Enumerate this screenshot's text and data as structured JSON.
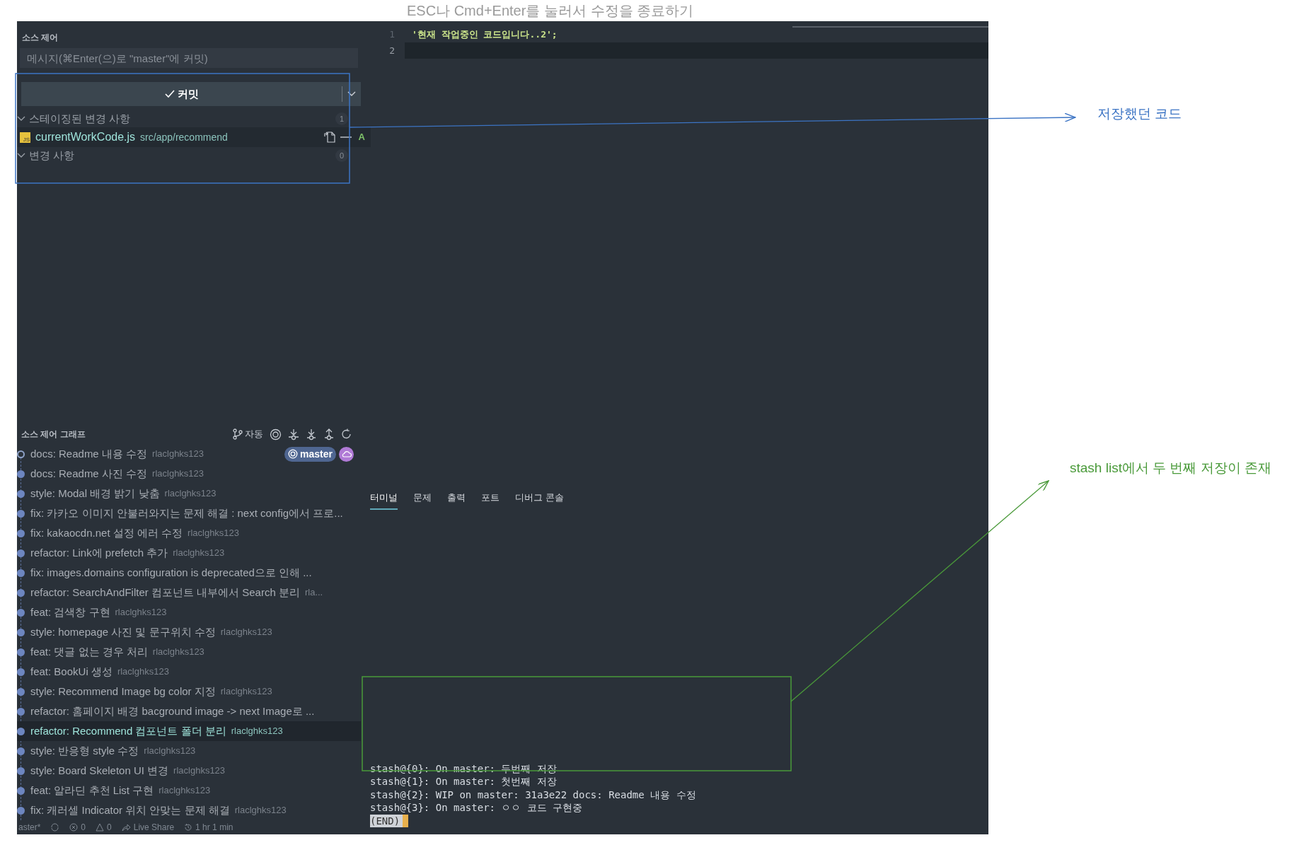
{
  "annotation_top": "ESC나 Cmd+Enter를 눌러서 수정을 종료하기",
  "source_control": {
    "title": "소스 제어",
    "message_placeholder": "메시지(⌘Enter(으)로 \"master\"에 커밋)",
    "commit_button": "커밋",
    "sections": [
      {
        "label": "스테이징된 변경 사항",
        "count": "1",
        "expanded": true,
        "files": [
          {
            "icon_text": "JS",
            "name": "currentWorkCode.js",
            "path": "src/app/recommend",
            "status": "A"
          }
        ]
      },
      {
        "label": "변경 사항",
        "count": "0",
        "expanded": true
      }
    ]
  },
  "graph": {
    "title": "소스 제어 그래프",
    "mode_label": "자동",
    "commits": [
      {
        "message": "docs: Readme 내용 수정",
        "author": "rlaclghks123",
        "current": true,
        "selected": false,
        "badges": [
          {
            "kind": "local",
            "label": "master"
          },
          {
            "kind": "remote"
          }
        ]
      },
      {
        "message": "docs: Readme 사진 수정",
        "author": "rlaclghks123",
        "current": false,
        "selected": false
      },
      {
        "message": "style: Modal 배경 밝기 낮춤",
        "author": "rlaclghks123",
        "current": false,
        "selected": false
      },
      {
        "message": "fix: 카카오 이미지 안불러와지는 문제 해결 : next config에서 프로...",
        "current": false,
        "selected": false
      },
      {
        "message": "fix: kakaocdn.net 설정 에러 수정",
        "author": "rlaclghks123",
        "current": false,
        "selected": false
      },
      {
        "message": "refactor: Link에 prefetch 추가",
        "author": "rlaclghks123",
        "current": false,
        "selected": false
      },
      {
        "message": "fix: images.domains configuration is deprecated으로 인해 ...",
        "current": false,
        "selected": false
      },
      {
        "message": "refactor: SearchAndFilter 컴포넌트 내부에서 Search 분리",
        "author": "rla...",
        "current": false,
        "selected": false
      },
      {
        "message": "feat: 검색창 구현",
        "author": "rlaclghks123",
        "current": false,
        "selected": false
      },
      {
        "message": "style: homepage 사진 및 문구위치 수정",
        "author": "rlaclghks123",
        "current": false,
        "selected": false
      },
      {
        "message": "feat: 댓글 없는 경우 처리",
        "author": "rlaclghks123",
        "current": false,
        "selected": false
      },
      {
        "message": "feat: BookUi 생성",
        "author": "rlaclghks123",
        "current": false,
        "selected": false
      },
      {
        "message": "style: Recommend Image bg color 지정",
        "author": "rlaclghks123",
        "current": false,
        "selected": false
      },
      {
        "message": "refactor: 홈페이지 배경 bacground image -> next Image로 ...",
        "current": false,
        "selected": false
      },
      {
        "message": "refactor: Recommend 컴포넌트 폴더 분리",
        "author": "rlaclghks123",
        "current": false,
        "selected": true
      },
      {
        "message": "style: 반응형 style 수정",
        "author": "rlaclghks123",
        "current": false,
        "selected": false
      },
      {
        "message": "style: Board Skeleton UI 변경",
        "author": "rlaclghks123",
        "current": false,
        "selected": false
      },
      {
        "message": "feat: 알라딘 추천 List 구현",
        "author": "rlaclghks123",
        "current": false,
        "selected": false
      },
      {
        "message": "fix: 캐러셀 Indicator 위치 안맞는 문제 해결",
        "author": "rlaclghks123",
        "current": false,
        "selected": false
      }
    ]
  },
  "status_bar": [
    {
      "kind": "branch",
      "text": "aster*"
    },
    {
      "kind": "errors",
      "text": "0"
    },
    {
      "kind": "warnings",
      "text": "0"
    },
    {
      "kind": "share",
      "text": "Live Share"
    },
    {
      "kind": "time",
      "text": "1 hr 1 min"
    }
  ],
  "editor": {
    "lines": [
      {
        "number": "1",
        "text": "'현재 작업중인 코드입니다..2';",
        "current": false
      },
      {
        "number": "2",
        "current": true
      }
    ]
  },
  "panel": {
    "tabs": [
      {
        "label": "터미널",
        "selected": true
      },
      {
        "label": "문제",
        "selected": false
      },
      {
        "label": "출력",
        "selected": false
      },
      {
        "label": "포트",
        "selected": false
      },
      {
        "label": "디버그 콘솔",
        "selected": false
      }
    ],
    "terminal_lines": [
      "stash@{0}: On master: 두번째 저장",
      "stash@{1}: On master: 첫번째 저장",
      "stash@{2}: WIP on master: 31a3e22 docs: Readme 내용 수정",
      "stash@{3}: On master: ㅇㅇ 코드 구현중"
    ],
    "end_marker": "(END)"
  },
  "annotations": [
    {
      "kind": "blue",
      "text": "저장했던 코드"
    },
    {
      "kind": "green",
      "text": "stash list에서 두 번째 저장이 존재"
    }
  ]
}
